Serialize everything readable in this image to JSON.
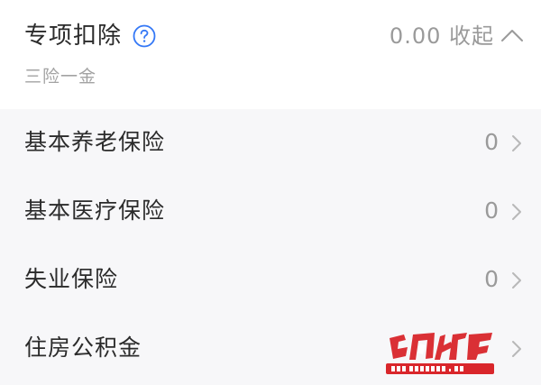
{
  "section": {
    "title": "专项扣除",
    "amount_label": "0.00 收起",
    "subtitle": "三险一金",
    "help_icon": "question-circle-icon",
    "collapse_icon": "chevron-up-icon",
    "accent_color": "#3478f6"
  },
  "items": [
    {
      "label": "基本养老保险",
      "value": "0",
      "icon": "chevron-right-icon"
    },
    {
      "label": "基本医疗保险",
      "value": "0",
      "icon": "chevron-right-icon"
    },
    {
      "label": "失业保险",
      "value": "0",
      "icon": "chevron-right-icon"
    },
    {
      "label": "住房公积金",
      "value": "",
      "icon": "chevron-right-icon"
    }
  ],
  "watermark": {
    "logo_text": "红网论坛",
    "logo_url_text": "BBS.REDNET.CN",
    "color": "#d9262b"
  }
}
